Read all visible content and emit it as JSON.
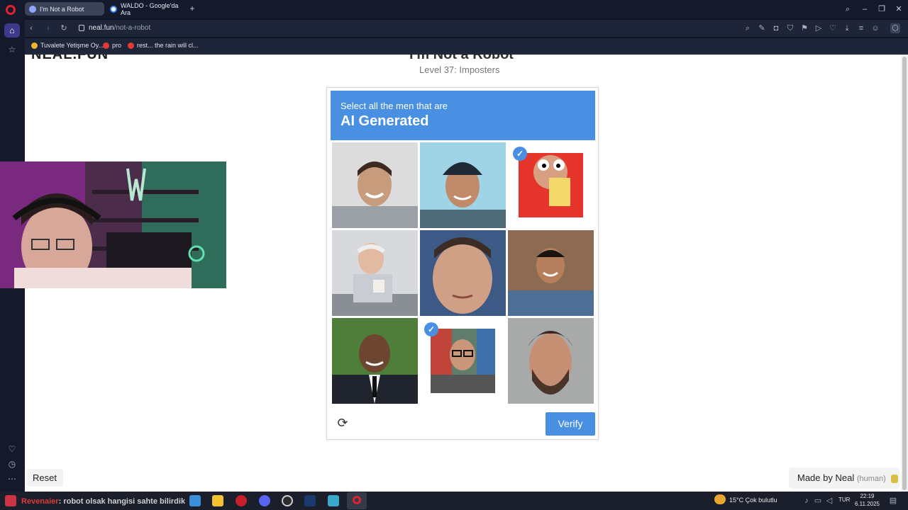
{
  "browser": {
    "tabs": [
      {
        "label": "I'm Not a Robot"
      },
      {
        "label": "WALDO - Google'da Ara"
      }
    ],
    "url_domain": "neal.fun",
    "url_path": "/not-a-robot",
    "bookmarks": [
      {
        "label": "Tuvalete Yetişme Oy..."
      },
      {
        "label": "pro"
      },
      {
        "label": "rest... the rain will cl..."
      }
    ]
  },
  "page": {
    "site_logo": "NEAL.FUN",
    "title": "I'm Not a Robot",
    "subtitle": "Level 37: Imposters"
  },
  "captcha": {
    "prompt_line1": "Select all the men that are",
    "prompt_line2": "AI Generated",
    "accent_color": "#4a90e2",
    "tiles": [
      {
        "selected": false
      },
      {
        "selected": false
      },
      {
        "selected": true
      },
      {
        "selected": false
      },
      {
        "selected": false
      },
      {
        "selected": false
      },
      {
        "selected": false
      },
      {
        "selected": true
      },
      {
        "selected": false
      }
    ],
    "check_glyph": "✓",
    "reload_icon": "⟳",
    "verify_label": "Verify"
  },
  "footer": {
    "reset_label": "Reset",
    "made_by": "Made by Neal",
    "made_by_note": "(human)"
  },
  "taskbar": {
    "ticker_name": "Revenaier",
    "ticker_text": ": robot olsak hangisi sahte bilirdik",
    "weather": "15°C  Çok bulutlu",
    "lang": "TUR",
    "time": "22:19",
    "date": "6.11.2025"
  }
}
